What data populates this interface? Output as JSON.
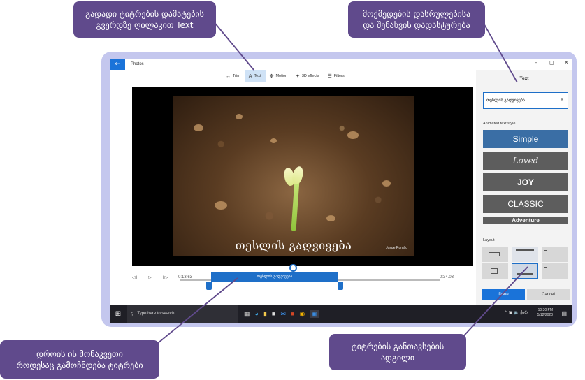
{
  "callouts": {
    "text_button": "გადადი ტიტრების დამატების\nგვერდზე ღილაკით Text",
    "done": "მოქმედების დასრულებისა\nდა შენახვის დადასტურება",
    "timing": "დროის ის მონაკვეთი\nროდესაც გამოჩნდება ტიტრები",
    "layout": "ტიტრების განთავსების\nადგილი"
  },
  "app": {
    "title": "Photos",
    "back_icon": "arrow-left-icon",
    "window_controls": [
      "–",
      "◻",
      "✕"
    ]
  },
  "toolbar": {
    "items": [
      {
        "label": "Trim",
        "icon": "trim-icon"
      },
      {
        "label": "Text",
        "icon": "text-icon",
        "active": true
      },
      {
        "label": "Motion",
        "icon": "motion-icon"
      },
      {
        "label": "3D effects",
        "icon": "3d-effects-icon"
      },
      {
        "label": "Filters",
        "icon": "filters-icon"
      }
    ]
  },
  "video": {
    "overlay_text": "თესლის გაღვივება",
    "credit": "Josue Romão"
  },
  "playback": {
    "current_time": "0:13.63",
    "end_time": "0:34.03",
    "clip_label": "თესლის გაღვივება"
  },
  "panel": {
    "title": "Text",
    "input_value": "თესლის გაღვივება",
    "animated_style_label": "Animated text style",
    "styles": [
      "Simple",
      "Loved",
      "JOY",
      "CLASSIC",
      "Adventure"
    ],
    "layout_label": "Layout",
    "done_label": "Done",
    "cancel_label": "Cancel"
  },
  "taskbar": {
    "search_placeholder": "Type here to search",
    "language": "ქარ",
    "time": "10:30 PM",
    "date": "5/12/2020"
  }
}
